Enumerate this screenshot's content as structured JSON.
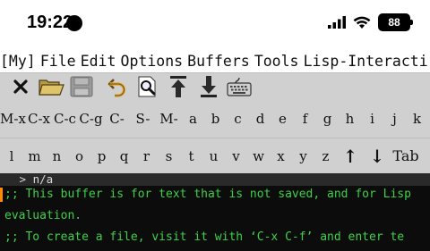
{
  "status_bar": {
    "time": "19:22",
    "battery": "88"
  },
  "menubar": {
    "items": [
      "[My]",
      "File",
      "Edit",
      "Options",
      "Buffers",
      "Tools",
      "Lisp-Interacti"
    ]
  },
  "toolbar": {
    "buttons": [
      "close-icon",
      "open-folder-icon",
      "save-disk-icon",
      "undo-icon",
      "search-icon",
      "scroll-top-icon",
      "scroll-down-icon",
      "keyboard-icon"
    ]
  },
  "keys": {
    "row1": [
      "M-x",
      "C-x",
      "C-c",
      "C-g",
      "C-",
      "S-",
      "M-",
      "a",
      "b",
      "c",
      "d",
      "e",
      "f",
      "g",
      "h",
      "i",
      "j",
      "k"
    ],
    "row2": [
      "l",
      "m",
      "n",
      "o",
      "p",
      "q",
      "r",
      "s",
      "t",
      "u",
      "v",
      "w",
      "x",
      "y",
      "z",
      "↑",
      "↓",
      "Tab"
    ]
  },
  "buffer": {
    "prompt": " > n/a",
    "lines": [
      ";; This buffer is for text that is not saved, and for Lisp",
      "evaluation.",
      ";; To create a file, visit it with ‘C-x C-f’ and enter te"
    ]
  }
}
